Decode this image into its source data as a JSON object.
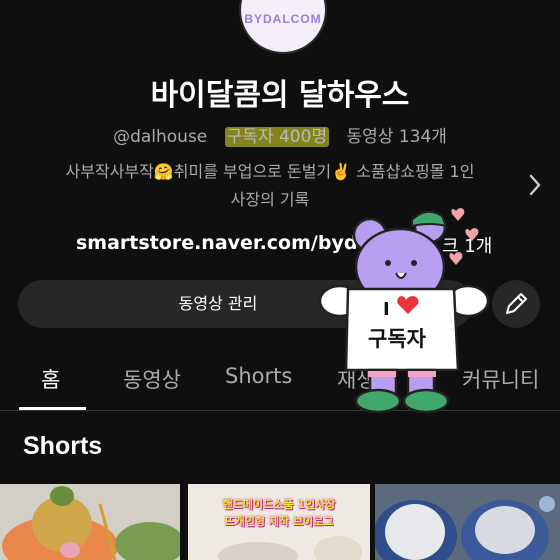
{
  "channel": {
    "avatar_text": "BYDALCOM",
    "name": "바이달콤의 달하우스",
    "handle": "@dalhouse",
    "subscribers": "구독자 400명",
    "videos": "동영상 134개",
    "description_line1": "사부작사부작🤗취미를 부업으로 돈벌기✌️ 소품샵쇼핑몰 1인",
    "description_line2": "사장의 기록",
    "link": "smartstore.naver.com/bydalco",
    "link_suffix": "크 1개"
  },
  "actions": {
    "manage_label": "동영상 관리"
  },
  "tabs": [
    "홈",
    "동영상",
    "Shorts",
    "재생",
    "커뮤니티"
  ],
  "section": {
    "title": "Shorts"
  },
  "thumbnails": {
    "thumb2_line1": "핸드메이드소품 1인사장",
    "thumb2_line2": "뜨개인형 제작 브이로그"
  },
  "sticker": {
    "line1": "I",
    "line2": "구독자"
  },
  "colors": {
    "background": "#0f0f0f",
    "highlight": "#e6e628",
    "sticker_purple": "#b89ef0",
    "heart": "#e8323c"
  }
}
